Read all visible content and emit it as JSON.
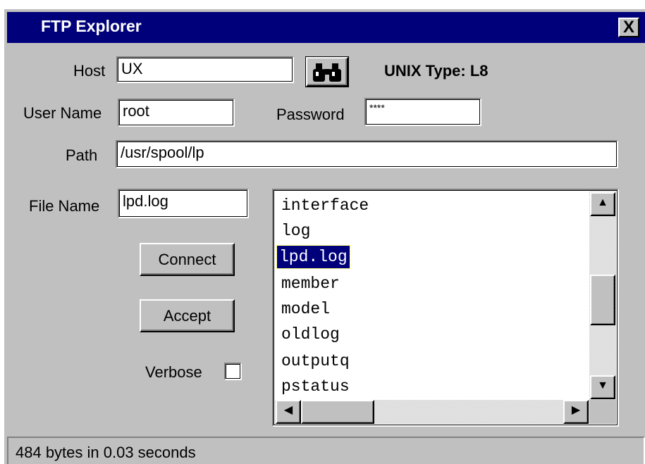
{
  "window": {
    "title": "FTP Explorer",
    "close_label": "X"
  },
  "host": {
    "label": "Host",
    "value": "UX"
  },
  "search_icon": "binoculars-icon",
  "system_type": "UNIX Type: L8",
  "user": {
    "label": "User Name",
    "value": "root"
  },
  "password": {
    "label": "Password",
    "value": "****"
  },
  "path": {
    "label": "Path",
    "value": "/usr/spool/lp"
  },
  "file_name": {
    "label": "File Name",
    "value": "lpd.log"
  },
  "buttons": {
    "connect": "Connect",
    "accept": "Accept"
  },
  "verbose": {
    "label": "Verbose",
    "checked": false
  },
  "file_list": {
    "items": [
      "interface",
      "log",
      "lpd.log",
      "member",
      "model",
      "oldlog",
      "outputq",
      "pstatus"
    ],
    "selected": "lpd.log"
  },
  "scroll": {
    "up": "▲",
    "down": "▼",
    "left": "◀",
    "right": "▶"
  },
  "status": "484 bytes in 0.03 seconds",
  "colors": {
    "titlebar": "#00007b",
    "face": "#c0c0c0",
    "selection": "#00007b"
  }
}
